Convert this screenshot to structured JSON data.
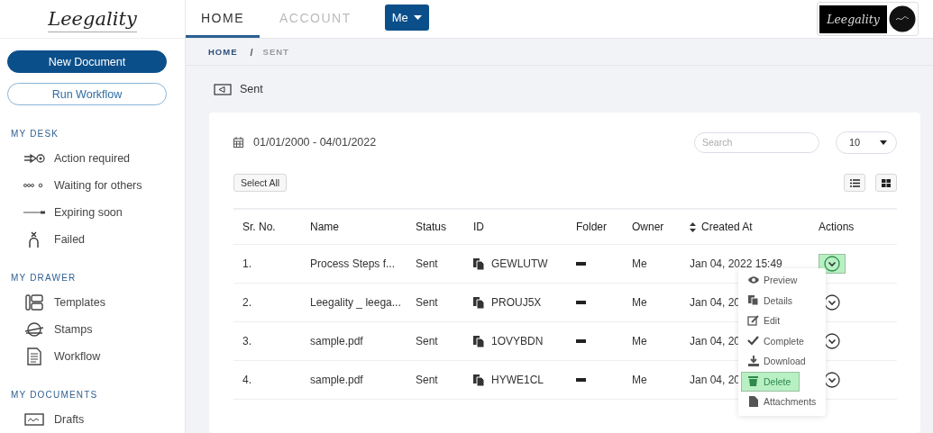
{
  "sidebar": {
    "logo": "Leegality",
    "buttons": [
      {
        "label": "New Document",
        "kind": "primary"
      },
      {
        "label": "Run Workflow",
        "kind": "outline"
      }
    ],
    "sections": [
      {
        "title": "MY DESK",
        "items": [
          "Action required",
          "Waiting for others",
          "Expiring soon",
          "Failed"
        ]
      },
      {
        "title": "MY DRAWER",
        "items": [
          "Templates",
          "Stamps",
          "Workflow"
        ]
      },
      {
        "title": "MY DOCUMENTS",
        "items": [
          "Drafts"
        ]
      }
    ]
  },
  "topbar": {
    "tabs": [
      {
        "label": "HOME",
        "selected": true
      },
      {
        "label": "ACCOUNT",
        "selected": false
      }
    ],
    "user_menu": "Me",
    "brand_logo": "Leegality"
  },
  "breadcrumb": {
    "items": [
      {
        "label": "HOME",
        "current": false
      },
      {
        "label": "SENT",
        "current": true
      }
    ],
    "separator": "/"
  },
  "page_title": "Sent",
  "filters": {
    "date_range": "01/01/2000 - 04/01/2022",
    "search": {
      "placeholder": "Search"
    },
    "page_size": "10",
    "select_all": "Select All"
  },
  "table": {
    "columns": [
      {
        "label": "Sr. No.",
        "sortable": false
      },
      {
        "label": "Name",
        "sortable": false
      },
      {
        "label": "Status",
        "sortable": false
      },
      {
        "label": "ID",
        "sortable": false
      },
      {
        "label": "Folder",
        "sortable": false
      },
      {
        "label": "Owner",
        "sortable": false
      },
      {
        "label": "Created At",
        "sortable": true
      },
      {
        "label": "Actions",
        "sortable": false
      }
    ],
    "rows": [
      {
        "sr": "1.",
        "name": "Process Steps f...",
        "status": "Sent",
        "id": "GEWLUTW",
        "owner": "Me",
        "created_at": "Jan 04, 2022 15:49",
        "menu_open": true
      },
      {
        "sr": "2.",
        "name": "Leegality _ leega...",
        "status": "Sent",
        "id": "PROUJ5X",
        "owner": "Me",
        "created_at": "Jan 04, 20",
        "menu_open": false
      },
      {
        "sr": "3.",
        "name": "sample.pdf",
        "status": "Sent",
        "id": "1OVYBDN",
        "owner": "Me",
        "created_at": "Jan 04, 20",
        "menu_open": false
      },
      {
        "sr": "4.",
        "name": "sample.pdf",
        "status": "Sent",
        "id": "HYWE1CL",
        "owner": "Me",
        "created_at": "Jan 04, 20",
        "menu_open": false
      }
    ]
  },
  "action_menu": {
    "items": [
      {
        "label": "Preview",
        "highlighted": false
      },
      {
        "label": "Details",
        "highlighted": false
      },
      {
        "label": "Edit",
        "highlighted": false
      },
      {
        "label": "Complete",
        "highlighted": false
      },
      {
        "label": "Download",
        "highlighted": false
      },
      {
        "label": "Delete",
        "highlighted": true
      },
      {
        "label": "Attachments",
        "highlighted": false
      }
    ]
  }
}
